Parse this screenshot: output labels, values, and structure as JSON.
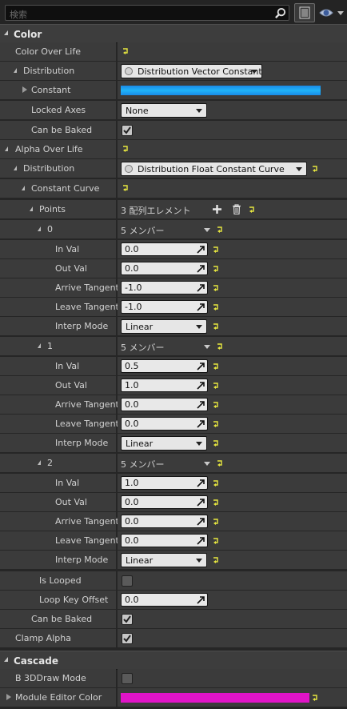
{
  "search": {
    "placeholder": "検索"
  },
  "toolbar": {
    "view_options": "view-options"
  },
  "categories": [
    {
      "id": "color",
      "title": "Color"
    },
    {
      "id": "cascade",
      "title": "Cascade"
    }
  ],
  "color_over_life": {
    "label": "Color Over Life",
    "distribution_label": "Distribution",
    "distribution_value": "Distribution Vector Constant",
    "constant_label": "Constant",
    "constant_color": "#1ea0f0",
    "locked_axes_label": "Locked Axes",
    "locked_axes_value": "None",
    "can_be_baked_label": "Can be Baked"
  },
  "alpha_over_life": {
    "label": "Alpha Over Life",
    "distribution_label": "Distribution",
    "distribution_value": "Distribution Float Constant Curve",
    "constant_curve_label": "Constant Curve",
    "points_label": "Points",
    "points_count": "3 配列エレメント",
    "members_text": "5 メンバー",
    "points": [
      {
        "index": "0",
        "in_val": "0.0",
        "out_val": "0.0",
        "arrive": "-1.0",
        "leave": "-1.0",
        "interp": "Linear"
      },
      {
        "index": "1",
        "in_val": "0.5",
        "out_val": "1.0",
        "arrive": "0.0",
        "leave": "0.0",
        "interp": "Linear"
      },
      {
        "index": "2",
        "in_val": "1.0",
        "out_val": "0.0",
        "arrive": "0.0",
        "leave": "0.0",
        "interp": "Linear"
      }
    ],
    "field_labels": {
      "in_val": "In Val",
      "out_val": "Out Val",
      "arrive": "Arrive Tangent",
      "leave": "Leave Tangent",
      "interp": "Interp Mode"
    },
    "is_looped_label": "Is Looped",
    "loop_key_offset_label": "Loop Key Offset",
    "loop_key_offset_value": "0.0",
    "can_be_baked_label": "Can be Baked",
    "clamp_alpha_label": "Clamp Alpha"
  },
  "cascade": {
    "b3d_label": "B 3DDraw Mode",
    "module_color_label": "Module Editor Color",
    "module_color": "#e014c8"
  },
  "colors": {
    "bg": "#262626",
    "row": "#3b3b3b",
    "reset_yellow": "#e8e840"
  }
}
